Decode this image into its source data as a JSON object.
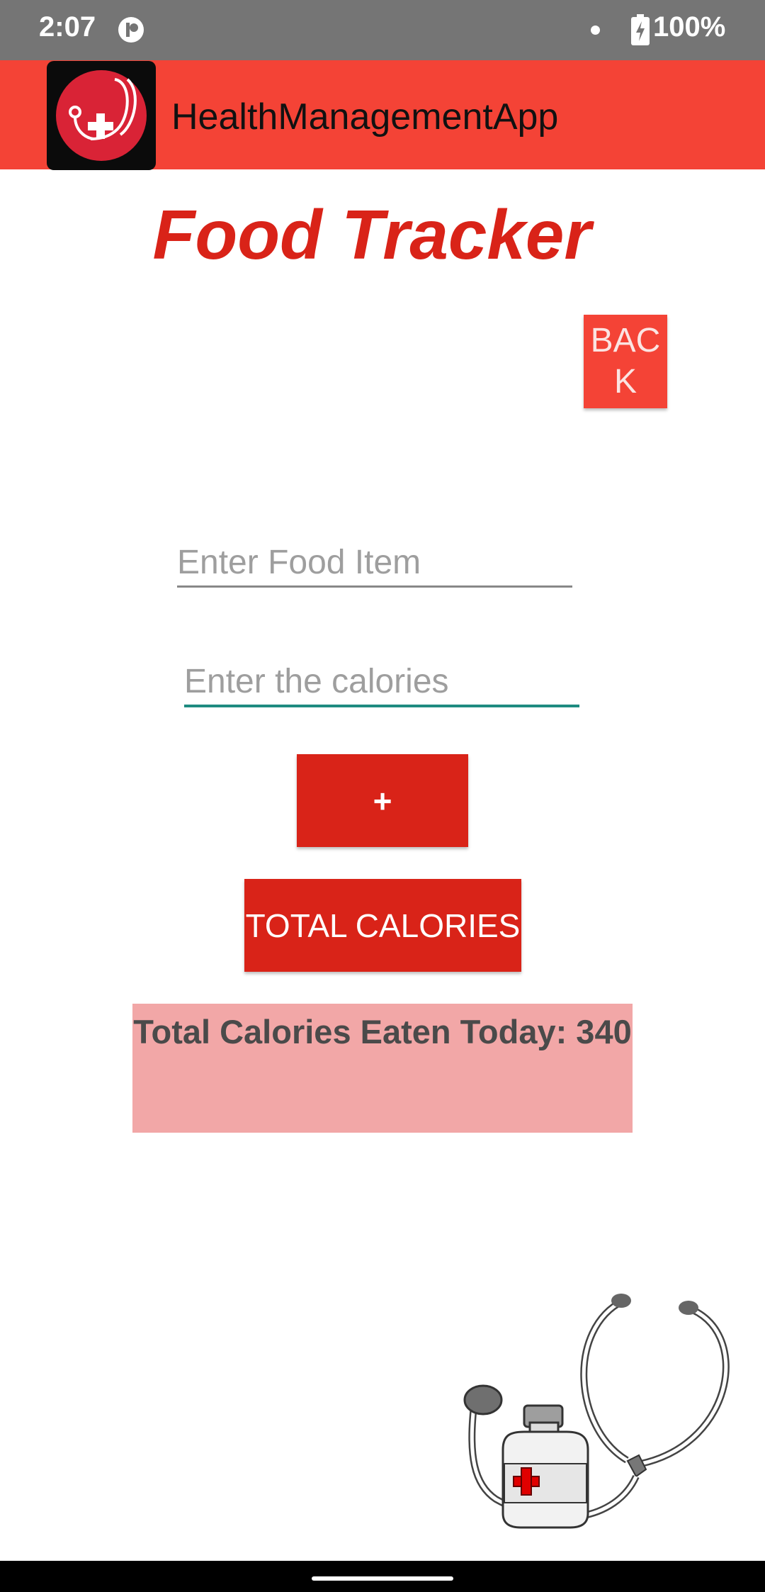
{
  "status_bar": {
    "time": "2:07",
    "battery": "100%",
    "icons": [
      "app-notification-icon",
      "dot-icon",
      "battery-charging-icon"
    ]
  },
  "app_bar": {
    "title": "HealthManagementApp",
    "logo_icon": "stethoscope-cross-icon",
    "color": "#f44336"
  },
  "page": {
    "title": "Food Tracker",
    "back_label": "BACK",
    "food_placeholder": "Enter Food Item",
    "calories_placeholder": "Enter the calories",
    "add_label": "+",
    "total_label": "TOTAL CALORIES",
    "result_text": "Total Calories Eaten Today: 340"
  },
  "colors": {
    "accent_red": "#d92318",
    "app_bar_red": "#f44336",
    "result_bg": "#f2a7a7",
    "input_focus": "#1e8b80"
  },
  "illustration": {
    "icon": "stethoscope-medicine-bottle-illustration"
  }
}
